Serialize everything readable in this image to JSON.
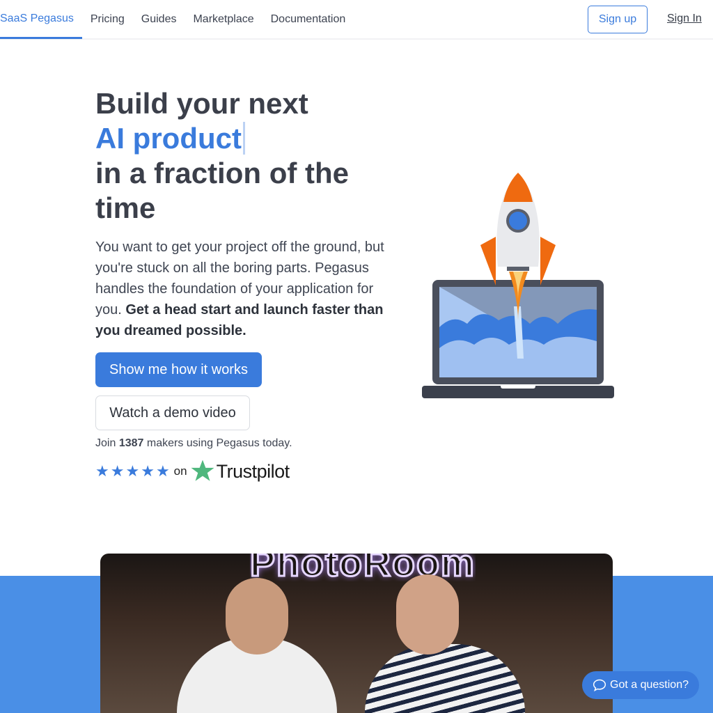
{
  "nav": {
    "brand": "SaaS Pegasus",
    "links": [
      "Pricing",
      "Guides",
      "Marketplace",
      "Documentation"
    ],
    "signup": "Sign up",
    "signin": "Sign In"
  },
  "hero": {
    "title_line1": "Build your next",
    "title_highlight": "AI product",
    "title_line3": "in a fraction of the time",
    "lead": "You want to get your project off the ground, but you're stuck on all the boring parts. Pegasus handles the foundation of your application for you.",
    "lead_bold": "Get a head start and launch faster than you dreamed possible.",
    "primary_button": "Show me how it works",
    "secondary_button": "Watch a demo video",
    "join_prefix": "Join",
    "join_count": "1387",
    "join_suffix": "makers using Pegasus today.",
    "rating_on": "on",
    "trustpilot": "Trustpilot",
    "stars": 5
  },
  "photo": {
    "sign": "PhotoRoom"
  },
  "chat": {
    "label": "Got a question?"
  },
  "colors": {
    "accent": "#3a7bdc",
    "band": "#4a8fe6",
    "trustpilot": "#00b67a"
  }
}
